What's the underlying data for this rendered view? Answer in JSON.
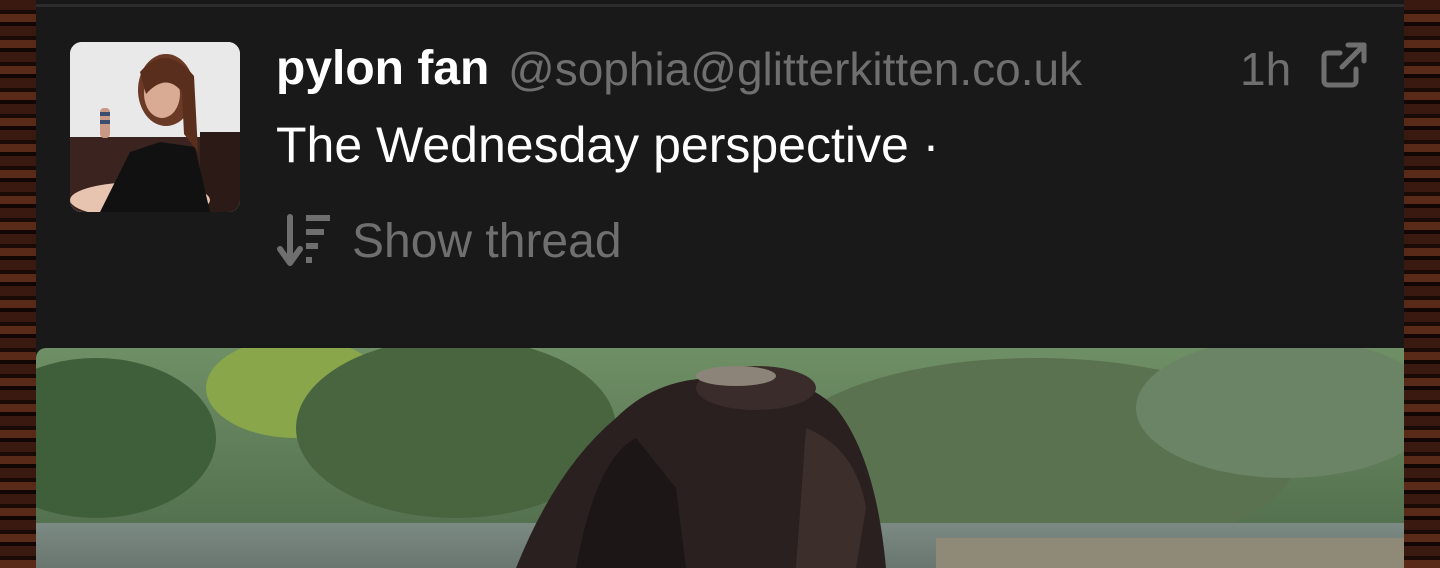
{
  "post": {
    "display_name": "pylon fan",
    "handle": "@sophia@glitterkitten.co.uk",
    "time": "1h",
    "content": "The Wednesday perspective ·",
    "show_thread_label": "Show thread"
  },
  "icons": {
    "open_external": "external-link-icon",
    "thread": "sort-descending-icon",
    "avatar": "user-avatar",
    "media": "video-thumbnail"
  },
  "colors": {
    "background": "#181818",
    "text_primary": "#ffffff",
    "text_muted": "#6f6f6f"
  }
}
